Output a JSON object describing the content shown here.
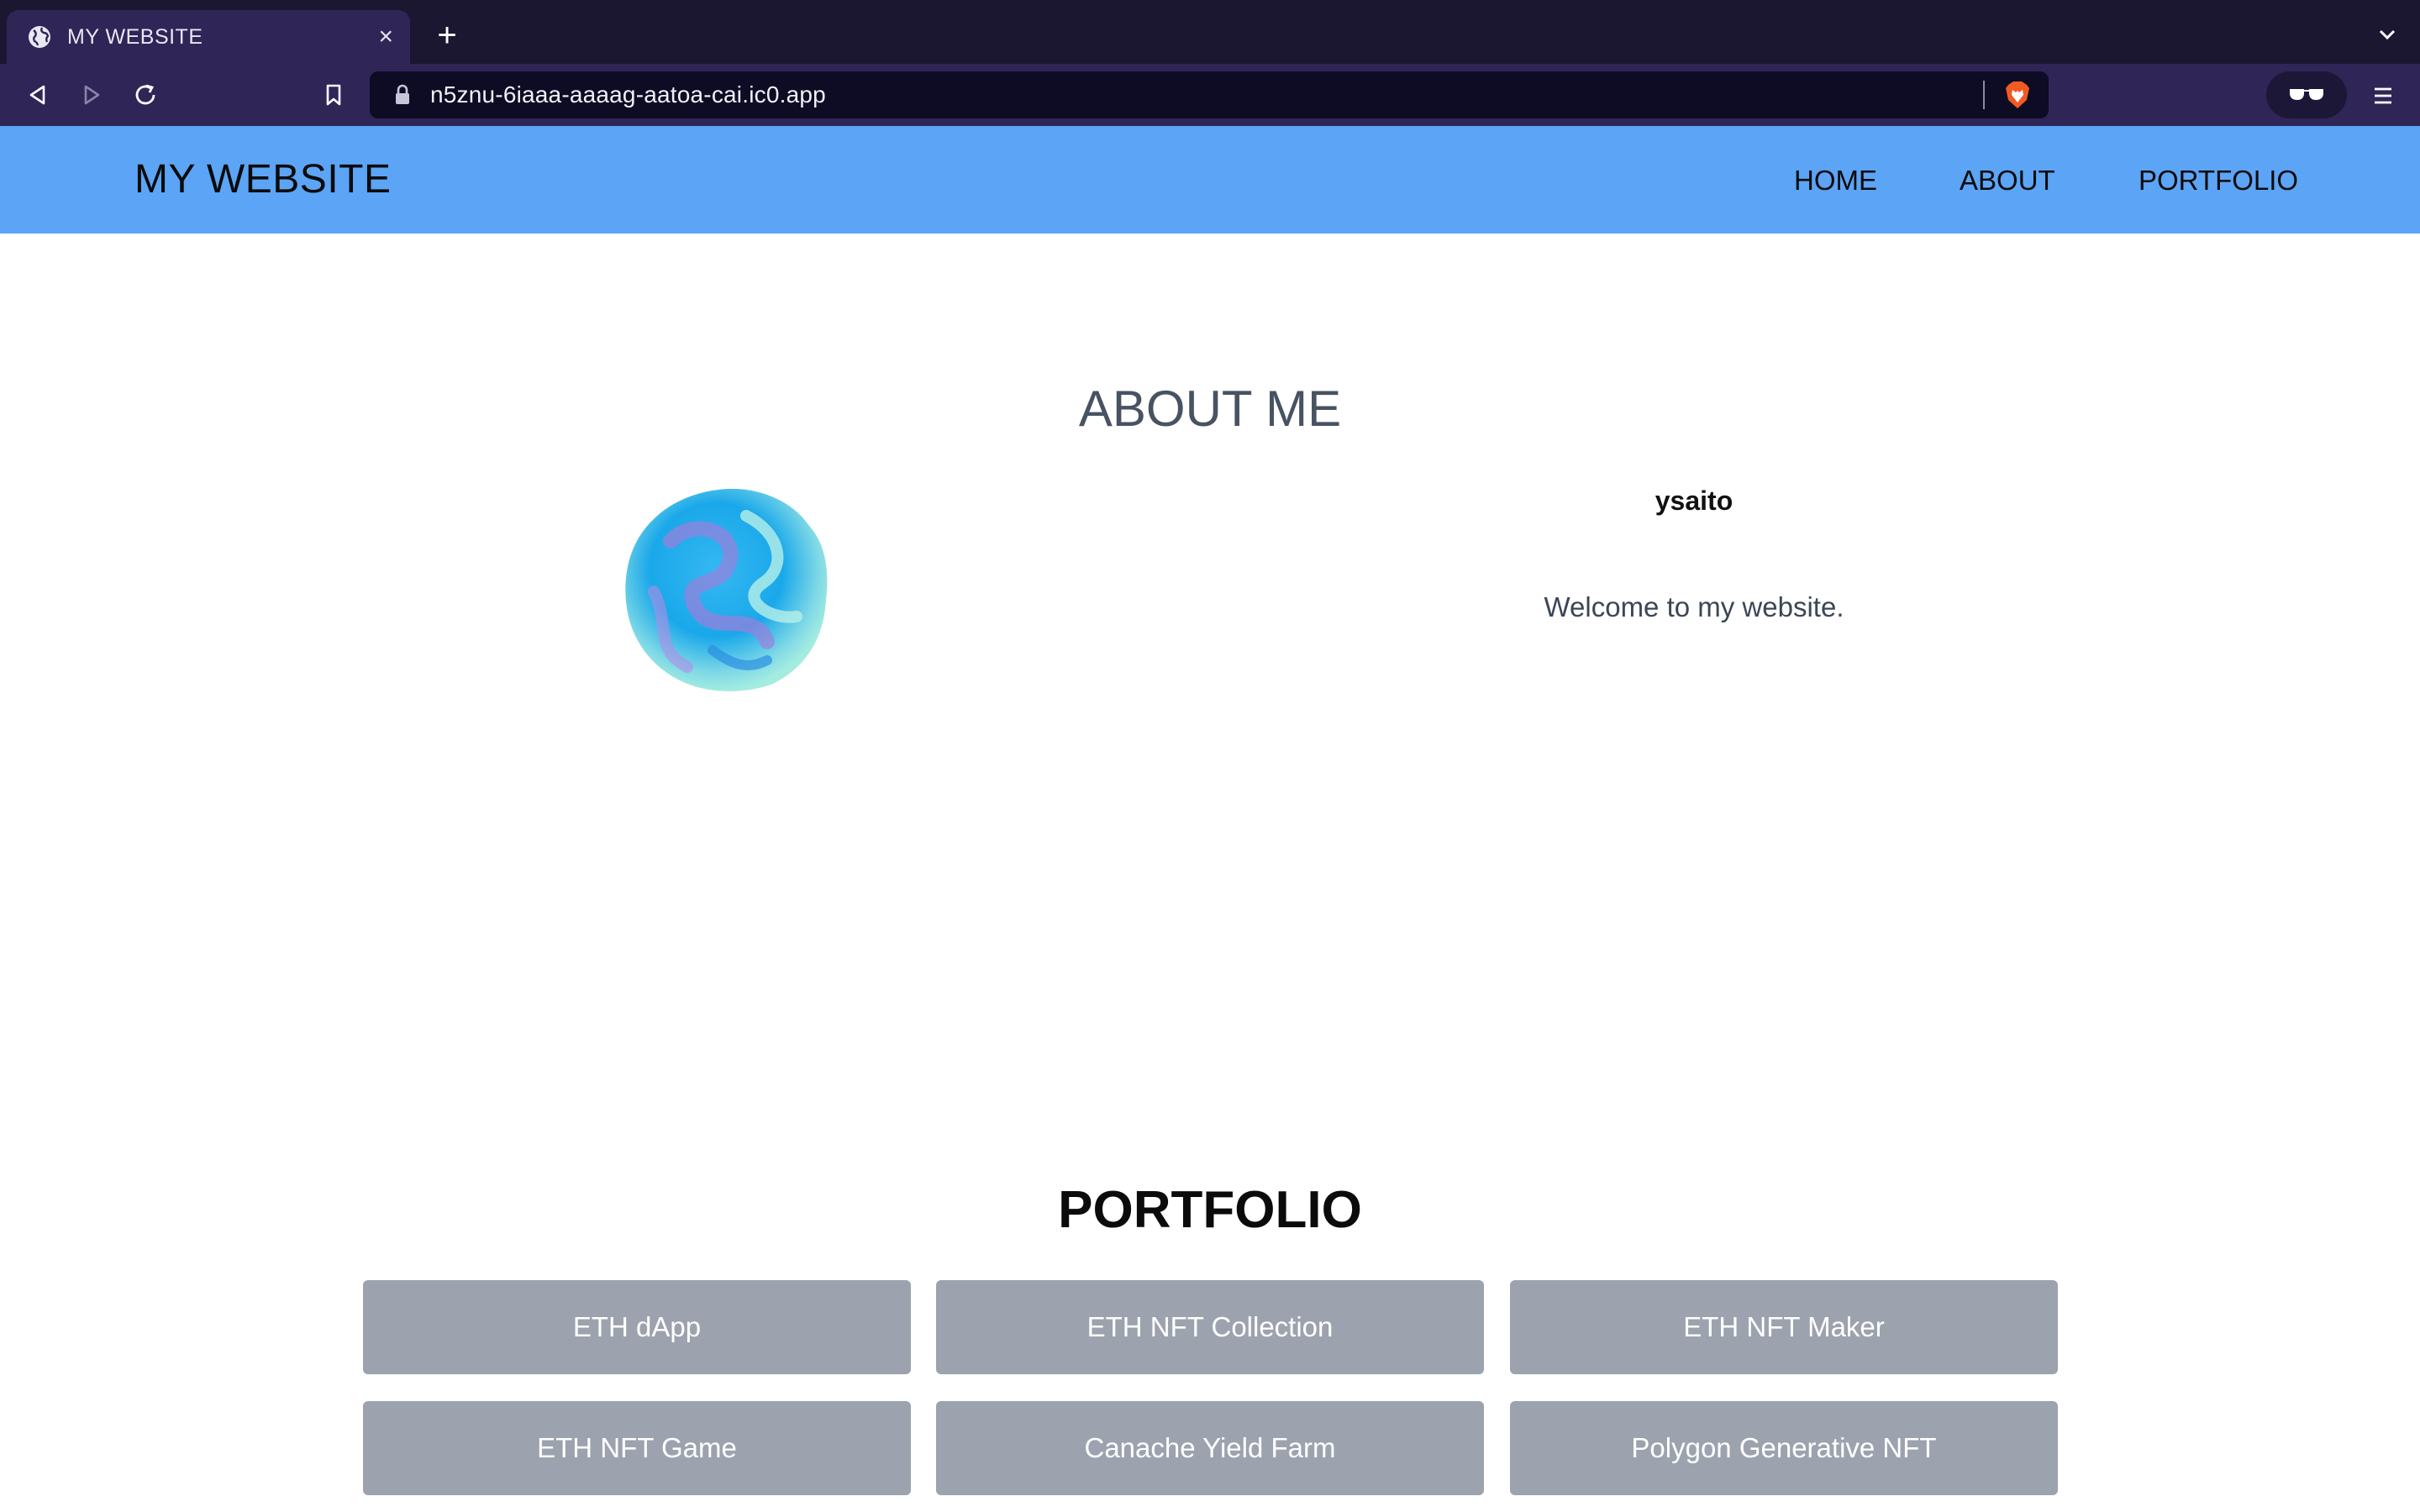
{
  "browser": {
    "tab_title": "MY WEBSITE",
    "tab_close": "×",
    "new_tab": "+",
    "url": "n5znu-6iaaa-aaaag-aatoa-cai.ic0.app"
  },
  "site": {
    "logo": "MY WEBSITE",
    "nav": [
      "HOME",
      "ABOUT",
      "PORTFOLIO"
    ],
    "about": {
      "title": "ABOUT ME",
      "name": "ysaito",
      "text": "Welcome to my website."
    },
    "portfolio": {
      "title": "PORTFOLIO",
      "items": [
        "ETH dApp",
        "ETH NFT Collection",
        "ETH NFT Maker",
        "ETH NFT Game",
        "Canache Yield Farm",
        "Polygon Generative NFT"
      ]
    }
  },
  "colors": {
    "header_bg": "#5ca4f5",
    "card_bg": "#9ca3ae",
    "browser_chrome": "#2f2557"
  }
}
